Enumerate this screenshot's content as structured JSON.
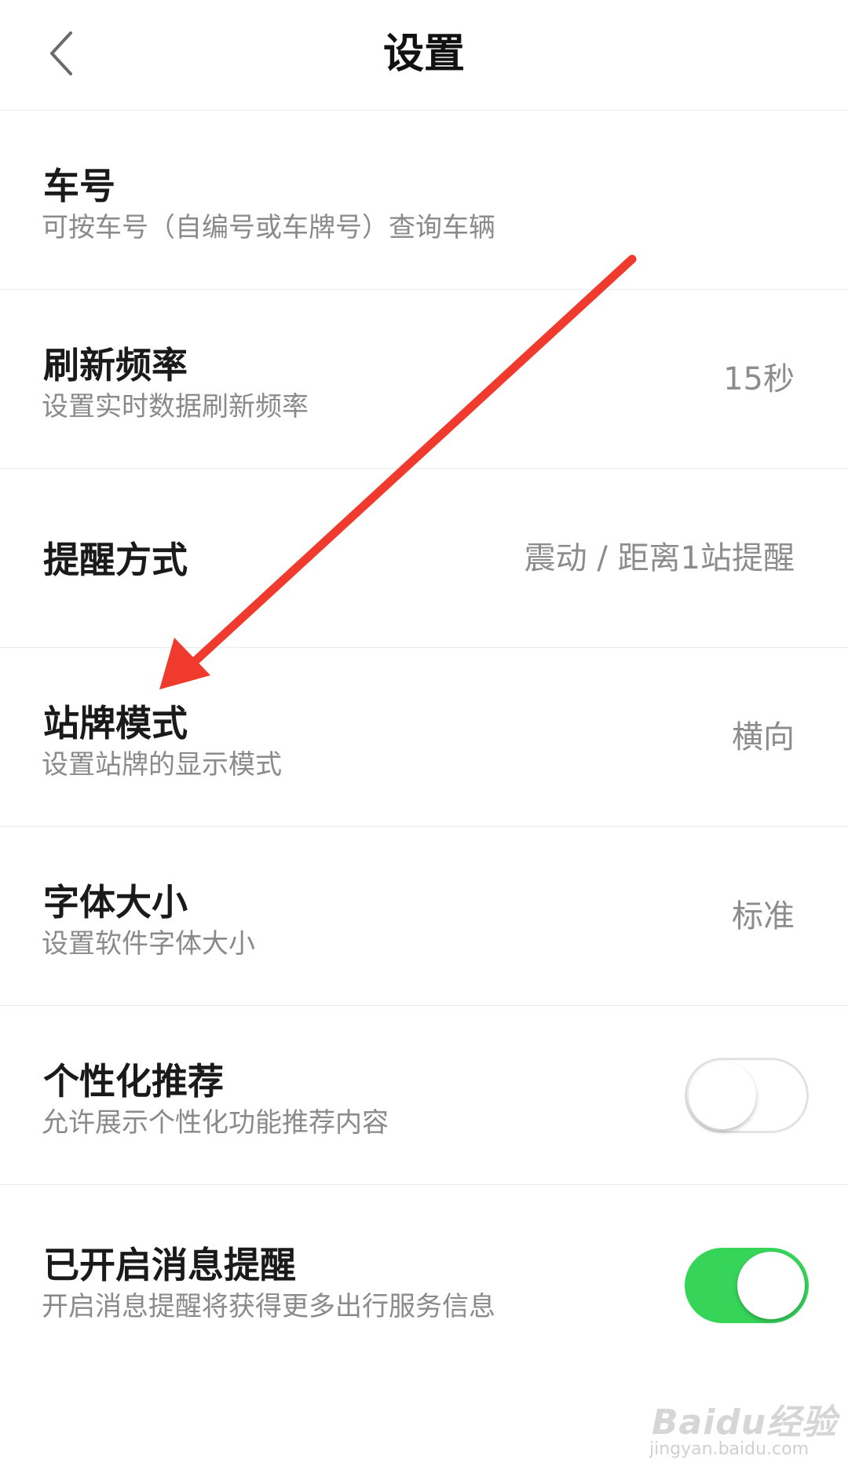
{
  "header": {
    "title": "设置",
    "back_icon": "chevron-left-icon"
  },
  "settings": [
    {
      "title": "车号",
      "subtitle": "可按车号（自编号或车牌号）查询车辆",
      "value": ""
    },
    {
      "title": "刷新频率",
      "subtitle": "设置实时数据刷新频率",
      "value": "15秒"
    },
    {
      "title": "提醒方式",
      "subtitle": "",
      "value": "震动 / 距离1站提醒"
    },
    {
      "title": "站牌模式",
      "subtitle": "设置站牌的显示模式",
      "value": "横向"
    },
    {
      "title": "字体大小",
      "subtitle": "设置软件字体大小",
      "value": "标准"
    },
    {
      "title": "个性化推荐",
      "subtitle": "允许展示个性化功能推荐内容",
      "toggle": false
    },
    {
      "title": "已开启消息提醒",
      "subtitle": "开启消息提醒将获得更多出行服务信息",
      "toggle": true
    }
  ],
  "annotation": {
    "arrow_color": "#f03a2e",
    "points_to": "站牌模式"
  },
  "colors": {
    "toggle_on": "#36d55a",
    "toggle_off_border": "#e2e2e2"
  },
  "watermark": {
    "brand": "Baidu经验",
    "url": "jingyan.baidu.com"
  }
}
